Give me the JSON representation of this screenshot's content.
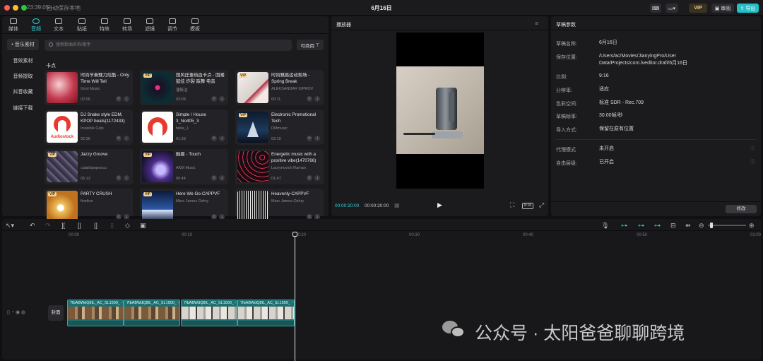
{
  "titlebar": {
    "time": "23:39:05",
    "autosave": "自动保存本地",
    "title": "6月16日",
    "vip": "VIP",
    "review": "审阅",
    "export": "导出"
  },
  "media_tabs": [
    {
      "label": "媒体"
    },
    {
      "label": "音频"
    },
    {
      "label": "文本"
    },
    {
      "label": "贴纸"
    },
    {
      "label": "特效"
    },
    {
      "label": "转场"
    },
    {
      "label": "滤镜"
    },
    {
      "label": "调节"
    },
    {
      "label": "模板"
    }
  ],
  "sidebar": [
    {
      "label": "• 音乐素材"
    },
    {
      "label": "音效素材"
    },
    {
      "label": "音频提取"
    },
    {
      "label": "抖音收藏"
    },
    {
      "label": "链接下载"
    }
  ],
  "search": {
    "placeholder": "搜索歌曲名称/歌手",
    "commercial": "可商用"
  },
  "section": "卡点",
  "tracks": [
    {
      "title": "时尚节奏魅力炫酷 - Only Time Will Tell",
      "artist": "Goni Music",
      "duration": "02:06"
    },
    {
      "title": "国风庄重热血卡点 - 国潮鼓炫 炸裂 踩舞 电音",
      "artist": "潘筱洁",
      "duration": "03:08"
    },
    {
      "title": "时尚魅惑运动现场 - Spring Break",
      "artist": "ALEKSANDAR KIPROV",
      "duration": "00:11"
    },
    {
      "title": "DJ Snake style EDM, KPOP beats(1172433)",
      "artist": "Invisible Cats",
      "duration": "02:36",
      "logo": "Audiostock"
    },
    {
      "title": "Simple / House 3_No405_3",
      "artist": "fable_1",
      "duration": "01:33"
    },
    {
      "title": "Electronic Promotional Tech",
      "artist": "DMmusic",
      "duration": "02:10"
    },
    {
      "title": "Jazzy Groove",
      "artist": "catalinpopescu",
      "duration": "05:12"
    },
    {
      "title": "触摸 - Touch",
      "artist": "AKM Music",
      "duration": "00:44"
    },
    {
      "title": "Energetic music with a positive vibe(1470766)",
      "artist": "Laurynovich Raman",
      "duration": "01:47"
    },
    {
      "title": "PARTY CRUSH",
      "artist": "fineline",
      "duration": ""
    },
    {
      "title": "Here We Go-CAPPVF",
      "artist": "Marc James Oshry",
      "duration": ""
    },
    {
      "title": "Heavenly-CAPPVF",
      "artist": "Marc James Oshry",
      "duration": ""
    }
  ],
  "player": {
    "title": "播放器",
    "current": "00:00:20:00",
    "total": "00:00:20:00",
    "ratio": "9:16"
  },
  "props": {
    "title": "草稿参数",
    "rows": [
      {
        "label": "草稿名称:",
        "value": "6月16日"
      },
      {
        "label": "保存位置:",
        "value": "/Users/ac/Movies/JianyingPro/User Data/Projects/com.lveditor.draft/6月16日"
      },
      {
        "label": "比例:",
        "value": "9:16"
      },
      {
        "label": "分辨率:",
        "value": "适应"
      },
      {
        "label": "色彩空间:",
        "value": "标准 SDR - Rec.709"
      },
      {
        "label": "草稿帧率:",
        "value": "30.00帧/秒"
      },
      {
        "label": "导入方式:",
        "value": "保留在原有位置"
      },
      {
        "label": "代理模式",
        "value": "未开启"
      },
      {
        "label": "自由层级:",
        "value": "已开启"
      }
    ],
    "modify": "修改"
  },
  "timeline": {
    "ruler": [
      "00:00",
      "00:10",
      "00:20",
      "00:30",
      "00:40",
      "00:50",
      "01:00"
    ],
    "cover": "封面",
    "clips": [
      {
        "label": "7fbABWdQ8IL_AC_SL1500_ -"
      },
      {
        "label": "7fbABWdQ8IL_AC_SL1500_ -"
      },
      {
        "label": "7fbABWdQ8IL_AC_SL1500_ -"
      },
      {
        "label": "7fbABWdQ8IL_AC_SL1500_ -"
      }
    ]
  },
  "watermark": "公众号 · 太阳爸爸聊聊跨境"
}
